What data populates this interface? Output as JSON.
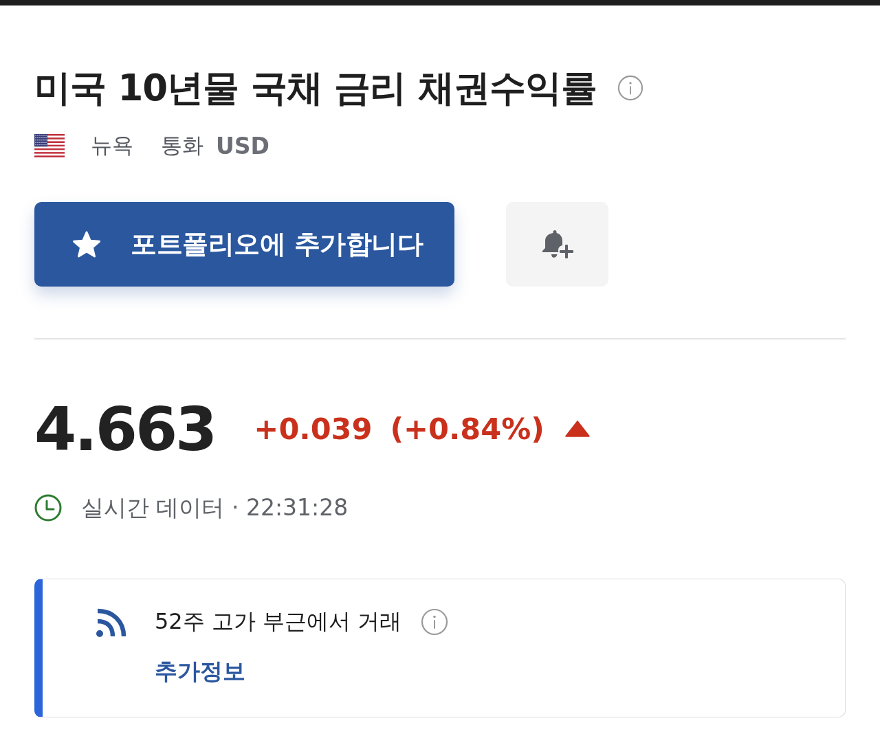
{
  "header": {
    "title": "미국 10년물 국채 금리 채권수익률",
    "exchange": "뉴욕",
    "currency_label": "통화",
    "currency": "USD"
  },
  "actions": {
    "portfolio_button": "포트폴리오에 추가합니다"
  },
  "quote": {
    "price": "4.663",
    "change": "+0.039",
    "change_percent": "(+0.84%)",
    "rising": true,
    "status": "실시간 데이터 · 22:31:28"
  },
  "signal": {
    "title": "52주 고가 부근에서 거래",
    "link": "추가정보"
  }
}
